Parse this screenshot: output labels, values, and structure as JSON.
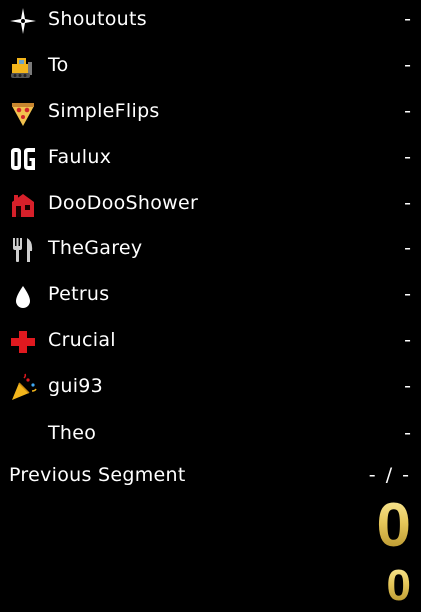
{
  "splits": [
    {
      "name": "Shoutouts",
      "time": "-",
      "icon": "sparkle-icon"
    },
    {
      "name": "To",
      "time": "-",
      "icon": "bulldozer-icon"
    },
    {
      "name": "SimpleFlips",
      "time": "-",
      "icon": "pizza-icon"
    },
    {
      "name": "Faulux",
      "time": "-",
      "icon": "og-logo-icon"
    },
    {
      "name": "DooDooShower",
      "time": "-",
      "icon": "house-icon"
    },
    {
      "name": "TheGarey",
      "time": "-",
      "icon": "fork-knife-icon"
    },
    {
      "name": "Petrus",
      "time": "-",
      "icon": "water-drop-icon"
    },
    {
      "name": "Crucial",
      "time": "-",
      "icon": "red-cross-icon"
    },
    {
      "name": "gui93",
      "time": "-",
      "icon": "party-popper-icon"
    },
    {
      "name": "Theo",
      "time": "-",
      "icon": ""
    }
  ],
  "previous_segment": {
    "label": "Previous Segment",
    "value": "- / -"
  },
  "timer": {
    "main": "0",
    "segment": "0"
  },
  "colors": {
    "background": "#000000",
    "text": "#ffffff",
    "timer_gold": "#e6c75a",
    "icon_red": "#e0191f",
    "icon_yellow": "#f2b51c"
  }
}
